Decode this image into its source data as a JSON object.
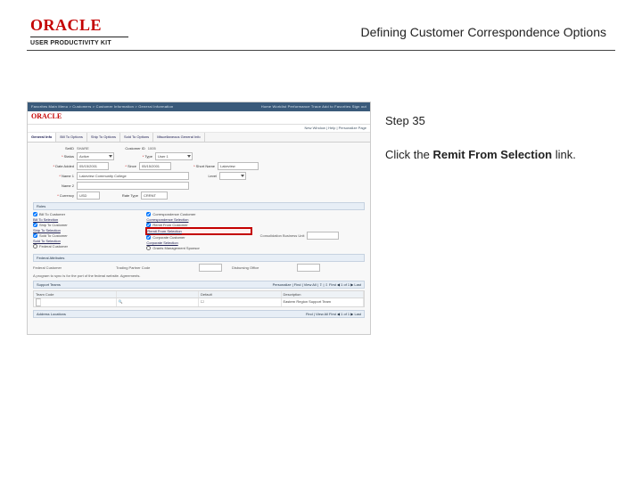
{
  "header": {
    "logo_text": "ORACLE",
    "logo_subtitle": "USER PRODUCTIVITY KIT",
    "doc_title": "Defining Customer Correspondence Options"
  },
  "right": {
    "step_label": "Step 35",
    "instruction_prefix": "Click the ",
    "instruction_link": "Remit From Selection",
    "instruction_suffix": " link."
  },
  "shot": {
    "nav_items": "Favorites   Main Menu > Customers > Customer Information > General Information",
    "nav_right": "Home   Worklist   Performance Trace   Add to Favorites   Sign out",
    "brand": "ORACLE",
    "crumb": "New Window | Help | Personalize Page",
    "tabs": [
      "General Info",
      "Bill To Options",
      "Ship To Options",
      "Sold To Options",
      "Miscellaneous General Info"
    ],
    "active_tab": 0,
    "form": {
      "setid_label": "SetID",
      "setid_value": "SHARE",
      "custid_label": "Customer ID",
      "custid_value": "1005",
      "status_label": "Status",
      "status_value": "Active",
      "date_label": "Date Added",
      "date_value": "05/15/2001",
      "since_label": "Since",
      "since_value": "05/15/2001",
      "type_label": "Type",
      "type_value": "User 1",
      "name1_label": "Name 1",
      "name1_value": "Lakeview Community College",
      "level_label": "Level",
      "shortname_label": "Short Name",
      "shortname_value": "Lakeview",
      "name2_label": "Name 2",
      "currency_label": "Currency",
      "currency_value": "USD",
      "ratetype_label": "Rate Type",
      "ratetype_value": "CRRNT"
    },
    "roles_hdr": "Roles",
    "roles_left": [
      {
        "label": "Bill To Customer",
        "checked": true
      },
      {
        "label": "Bill To Selection",
        "link": true
      },
      {
        "label": "Ship To Customer",
        "checked": true
      },
      {
        "label": "Ship To Selection",
        "link": true
      },
      {
        "label": "Sold To Customer",
        "checked": true
      },
      {
        "label": "Sold To Selection",
        "link": true
      },
      {
        "label": "Federal Customer",
        "checked": false
      }
    ],
    "roles_mid": [
      {
        "label": "Correspondence Customer",
        "checked": true
      },
      {
        "label": "Correspondence Selection",
        "link": true
      },
      {
        "label": "Remit From Customer",
        "checked": true
      },
      {
        "label": "Remit From Selection",
        "link": true,
        "highlight": true
      },
      {
        "label": "Corporate Customer",
        "checked": true
      },
      {
        "label": "Corporate Selection",
        "link": true
      },
      {
        "label": "Grants Management Sponsor",
        "checked": false
      }
    ],
    "consol_label": "Consolidation Business Unit",
    "fedattr_hdr": "Federal Attributes",
    "fedattr_left": "Federal Customer",
    "fedattr_mid": "Trading Partner Code",
    "fedattr_right": "Disbursing Office",
    "fed_note": "A program to sync is for the port of the federal website. Agreements.",
    "support_hdr": "Support Teams",
    "support_tools": "Personalize | Find | View All | ⇧ | ⇩   First ◀ 1 of 1 ▶ Last",
    "support_cols": [
      "Team Code",
      "",
      "Default",
      "Description"
    ],
    "support_row": [
      "",
      "🔍",
      "☐",
      "Eastern Region Support Team"
    ],
    "addr_hdr": "Address Locations",
    "addr_tools": "Find | View All   First ◀ 1 of 1 ▶ Last"
  }
}
